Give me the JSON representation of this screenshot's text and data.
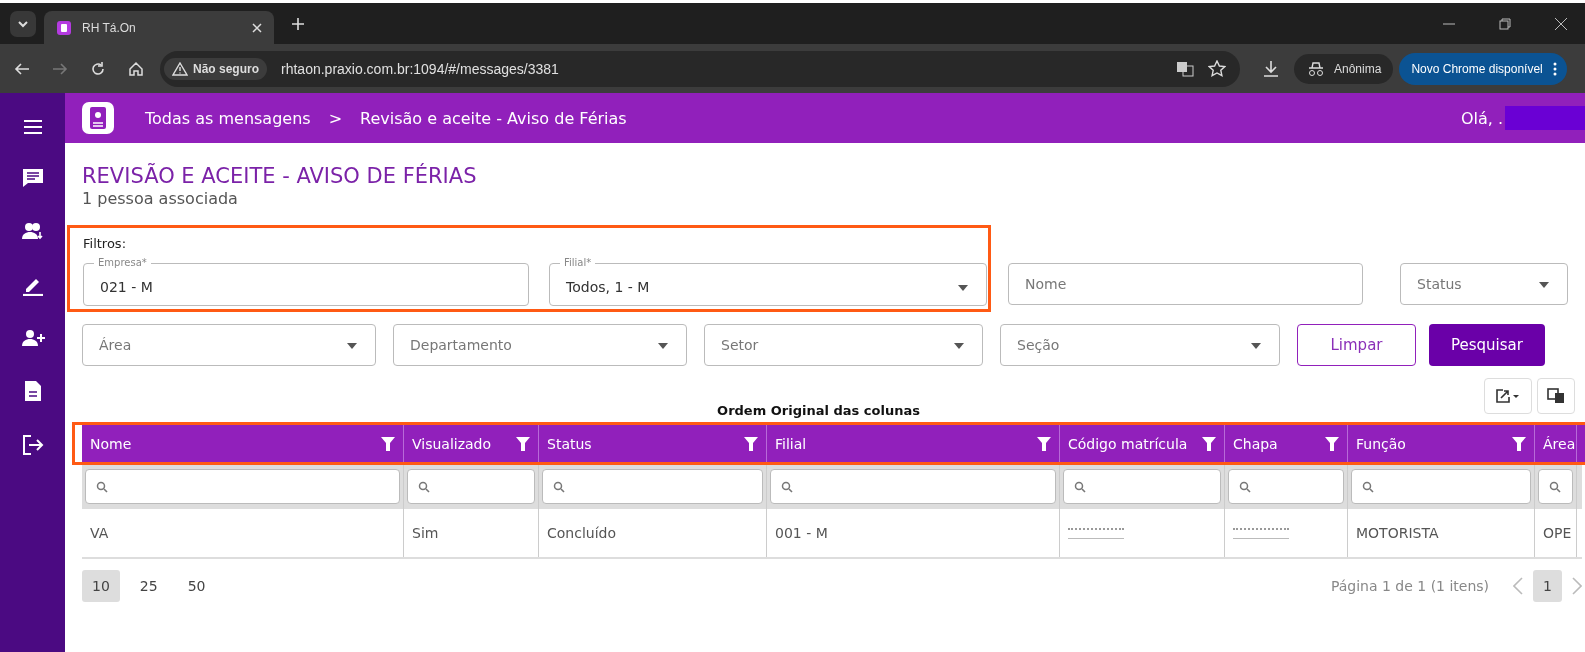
{
  "browser": {
    "tabs": [
      {
        "title": "RH Tá.On",
        "selected": true
      }
    ],
    "security_label": "Não seguro",
    "url": "rhtaon.praxio.com.br:1094/#/messages/3381",
    "profile": "Anônima",
    "update_button": "Novo Chrome disponível"
  },
  "header": {
    "breadcrumbs": [
      "Todas as mensagens",
      "Revisão e aceite - Aviso de Férias"
    ],
    "separator": ">",
    "greeting": "Olá, ."
  },
  "page": {
    "title": "REVISÃO E ACEITE - AVISO DE FÉRIAS",
    "subtitle": "1 pessoa associada"
  },
  "filters": {
    "label": "Filtros:",
    "fields": [
      {
        "kind": "text",
        "label": "Empresa*",
        "value": "021 - M"
      },
      {
        "kind": "select",
        "label": "Filial*",
        "value": "Todos, 1 - M"
      },
      {
        "kind": "text",
        "placeholder": "Nome"
      },
      {
        "kind": "select",
        "placeholder": "Status"
      },
      {
        "kind": "select",
        "placeholder": "Área"
      },
      {
        "kind": "select",
        "placeholder": "Departamento"
      },
      {
        "kind": "select",
        "placeholder": "Setor"
      },
      {
        "kind": "select",
        "placeholder": "Seção"
      }
    ],
    "buttons": [
      "Limpar",
      "Pesquisar"
    ]
  },
  "table": {
    "caption": "Ordem Original das colunas",
    "columns": [
      "Nome",
      "Visualizado",
      "Status",
      "Filial",
      "Código matrícula",
      "Chapa",
      "Função",
      "Área"
    ],
    "rows": [
      [
        "VA",
        "Sim",
        "Concluído",
        "001 - M",
        "",
        "",
        "MOTORISTA",
        "OPE"
      ]
    ]
  },
  "pagination": {
    "sizes": [
      {
        "label": "10",
        "selected": true
      },
      {
        "label": "25",
        "selected": false
      },
      {
        "label": "50",
        "selected": false
      }
    ],
    "info": "Página 1 de 1 (1 itens)",
    "pages": [
      {
        "label": "1",
        "selected": true
      }
    ]
  }
}
